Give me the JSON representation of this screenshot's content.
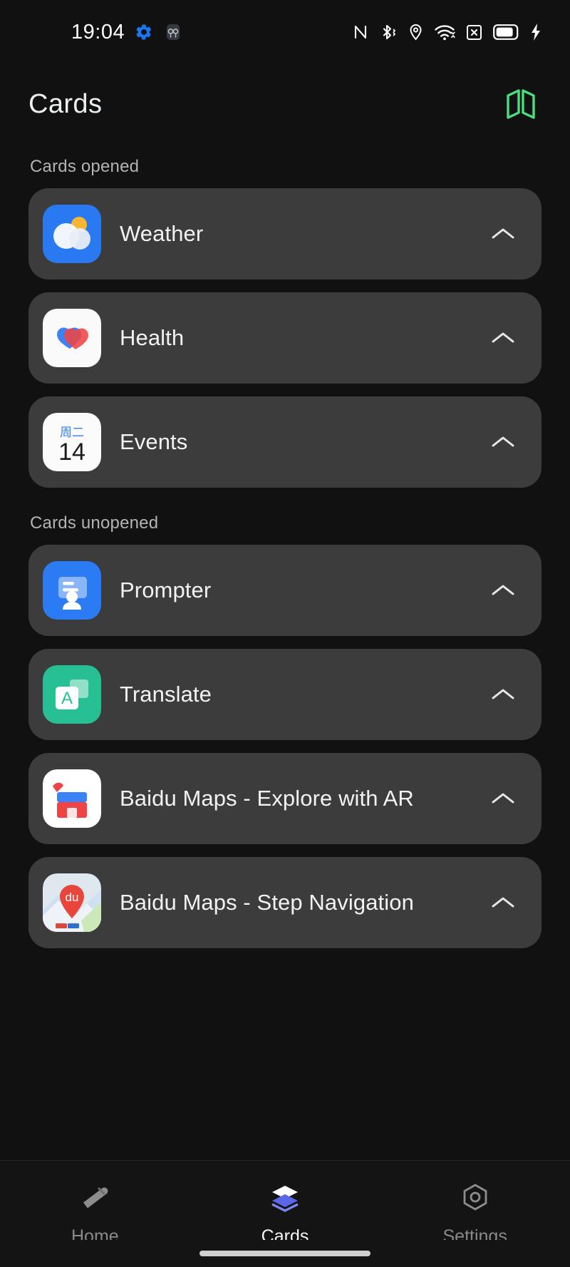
{
  "statusbar": {
    "time": "19:04",
    "left_icons": [
      {
        "name": "gear-icon",
        "color": "#1b76f2"
      },
      {
        "name": "glasses-icon",
        "color": "#9aa0a6"
      }
    ],
    "right_icons": [
      {
        "name": "nfc-icon"
      },
      {
        "name": "bluetooth-icon"
      },
      {
        "name": "location-icon"
      },
      {
        "name": "wifi-icon"
      },
      {
        "name": "sim-off-icon"
      },
      {
        "name": "battery-icon"
      },
      {
        "name": "charging-bolt-icon"
      }
    ]
  },
  "header": {
    "title": "Cards",
    "action_icon": "cards-stack-icon",
    "action_color": "#4ade80"
  },
  "sections": [
    {
      "label": "Cards opened",
      "items": [
        {
          "label": "Weather",
          "icon": "weather-icon",
          "chevron": "chevron-up-icon"
        },
        {
          "label": "Health",
          "icon": "health-icon",
          "chevron": "chevron-up-icon"
        },
        {
          "label": "Events",
          "icon": "calendar-icon",
          "chevron": "chevron-up-icon",
          "calendar_weekday": "周二",
          "calendar_day": "14"
        }
      ]
    },
    {
      "label": "Cards unopened",
      "items": [
        {
          "label": "Prompter",
          "icon": "prompter-icon",
          "chevron": "chevron-up-icon"
        },
        {
          "label": "Translate",
          "icon": "translate-icon",
          "chevron": "chevron-up-icon",
          "glyph": "A"
        },
        {
          "label": "Baidu Maps - Explore with AR",
          "icon": "baidu-ar-icon",
          "chevron": "chevron-up-icon"
        },
        {
          "label": "Baidu Maps - Step Navigation",
          "icon": "baidu-nav-icon",
          "chevron": "chevron-up-icon",
          "glyph": "du"
        }
      ]
    }
  ],
  "bottomnav": {
    "items": [
      {
        "label": "Home",
        "icon": "pen-icon",
        "active": false
      },
      {
        "label": "Cards",
        "icon": "cards-icon",
        "active": true
      },
      {
        "label": "Settings",
        "icon": "gear-hex-icon",
        "active": false
      }
    ]
  }
}
